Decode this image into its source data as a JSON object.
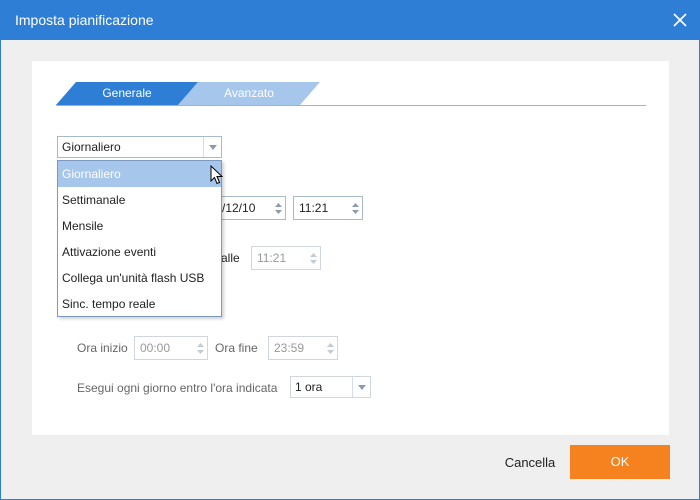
{
  "window": {
    "title": "Imposta pianificazione"
  },
  "tabs": [
    {
      "label": "Generale",
      "active": true
    },
    {
      "label": "Avanzato",
      "active": false
    }
  ],
  "schedule_type": {
    "selected": "Giornaliero",
    "options": [
      "Giornaliero",
      "Settimanale",
      "Mensile",
      "Attivazione eventi",
      "Collega un'unità flash USB",
      "Sinc. tempo reale"
    ]
  },
  "start": {
    "date_partial": "/12/10",
    "time": "11:21"
  },
  "interval": {
    "label_partial": "alle",
    "time": "11:21"
  },
  "range": {
    "start_label": "Ora inizio",
    "start_value": "00:00",
    "end_label": "Ora fine",
    "end_value": "23:59"
  },
  "repeat": {
    "label": "Esegui ogni giorno entro l'ora indicata",
    "value": "1 ora"
  },
  "footer": {
    "cancel_label": "Cancella",
    "ok_label": "OK"
  },
  "colors": {
    "titlebar": "#2f7ed6",
    "tab_active": "#2f7ed6",
    "tab_inactive": "#a7c6ec",
    "ok_button": "#f5821f",
    "selection": "#a7c6ec"
  }
}
